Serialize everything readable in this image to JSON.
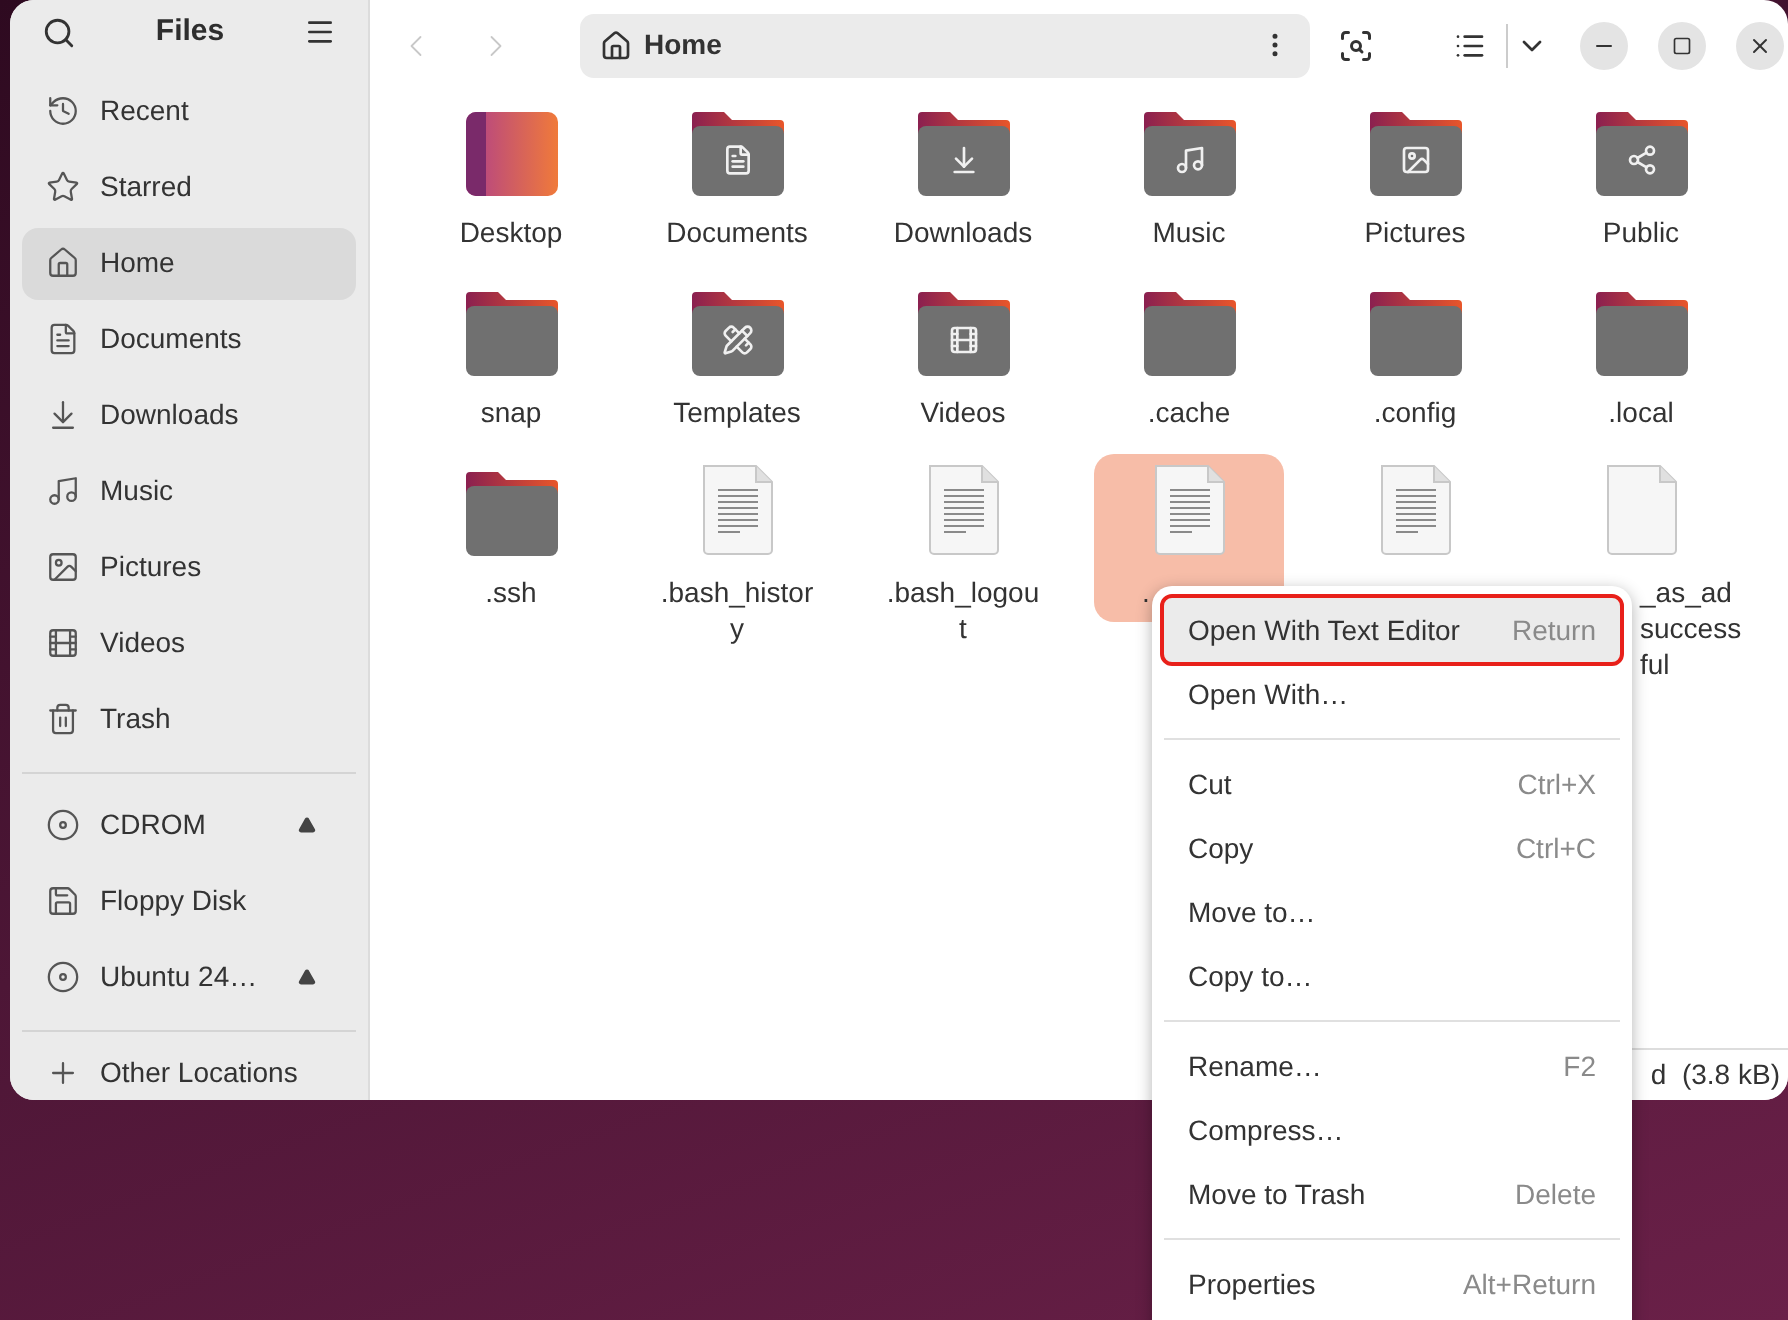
{
  "sidebar": {
    "title": "Files",
    "places": [
      {
        "label": "Recent",
        "selected": false
      },
      {
        "label": "Starred",
        "selected": false
      },
      {
        "label": "Home",
        "selected": true
      },
      {
        "label": "Documents",
        "selected": false
      },
      {
        "label": "Downloads",
        "selected": false
      },
      {
        "label": "Music",
        "selected": false
      },
      {
        "label": "Pictures",
        "selected": false
      },
      {
        "label": "Videos",
        "selected": false
      },
      {
        "label": "Trash",
        "selected": false
      }
    ],
    "devices": [
      {
        "label": "CDROM",
        "kind": "disc",
        "eject": true
      },
      {
        "label": "Floppy Disk",
        "kind": "floppy",
        "eject": false
      },
      {
        "label": "Ubuntu 24…",
        "kind": "disc",
        "eject": true
      }
    ],
    "other": {
      "label": "Other Locations"
    }
  },
  "path_bar": {
    "label": "Home"
  },
  "files": [
    {
      "kind": "desktop",
      "lines": [
        "Desktop"
      ],
      "selected": false
    },
    {
      "kind": "documents",
      "lines": [
        "Documents"
      ],
      "selected": false
    },
    {
      "kind": "downloads",
      "lines": [
        "Downloads"
      ],
      "selected": false
    },
    {
      "kind": "music",
      "lines": [
        "Music"
      ],
      "selected": false
    },
    {
      "kind": "pictures",
      "lines": [
        "Pictures"
      ],
      "selected": false
    },
    {
      "kind": "public",
      "lines": [
        "Public"
      ],
      "selected": false
    },
    {
      "kind": "folder",
      "lines": [
        "snap"
      ],
      "selected": false
    },
    {
      "kind": "templates",
      "lines": [
        "Templates"
      ],
      "selected": false
    },
    {
      "kind": "videos",
      "lines": [
        "Videos"
      ],
      "selected": false
    },
    {
      "kind": "folder",
      "lines": [
        ".cache"
      ],
      "selected": false
    },
    {
      "kind": "folder",
      "lines": [
        ".config"
      ],
      "selected": false
    },
    {
      "kind": "folder",
      "lines": [
        ".local"
      ],
      "selected": false
    },
    {
      "kind": "folder",
      "lines": [
        ".ssh"
      ],
      "selected": false
    },
    {
      "kind": "text",
      "lines": [
        ".bash_histor",
        "y"
      ],
      "selected": false
    },
    {
      "kind": "text",
      "lines": [
        ".bash_logou",
        "t"
      ],
      "selected": false
    },
    {
      "kind": "text",
      "lines": [
        "."
      ],
      "selected": true
    },
    {
      "kind": "text",
      "selected": false
    },
    {
      "kind": "blank",
      "lines": [
        "_as_ad",
        "success",
        "ful"
      ],
      "selected": false
    }
  ],
  "status": {
    "text": "d  (3.8 kB)"
  },
  "context_menu": {
    "groups": [
      [
        {
          "label": "Open With Text Editor",
          "shortcut": "Return",
          "selected": true
        },
        {
          "label": "Open With…",
          "selected": false
        }
      ],
      [
        {
          "label": "Cut",
          "shortcut": "Ctrl+X",
          "selected": false
        },
        {
          "label": "Copy",
          "shortcut": "Ctrl+C",
          "selected": false
        },
        {
          "label": "Move to…",
          "selected": false
        },
        {
          "label": "Copy to…",
          "selected": false
        }
      ],
      [
        {
          "label": "Rename…",
          "shortcut": "F2",
          "selected": false
        },
        {
          "label": "Compress…",
          "selected": false
        },
        {
          "label": "Move to Trash",
          "shortcut": "Delete",
          "selected": false
        }
      ],
      [
        {
          "label": "Properties",
          "shortcut": "Alt+Return",
          "selected": false
        }
      ]
    ]
  }
}
